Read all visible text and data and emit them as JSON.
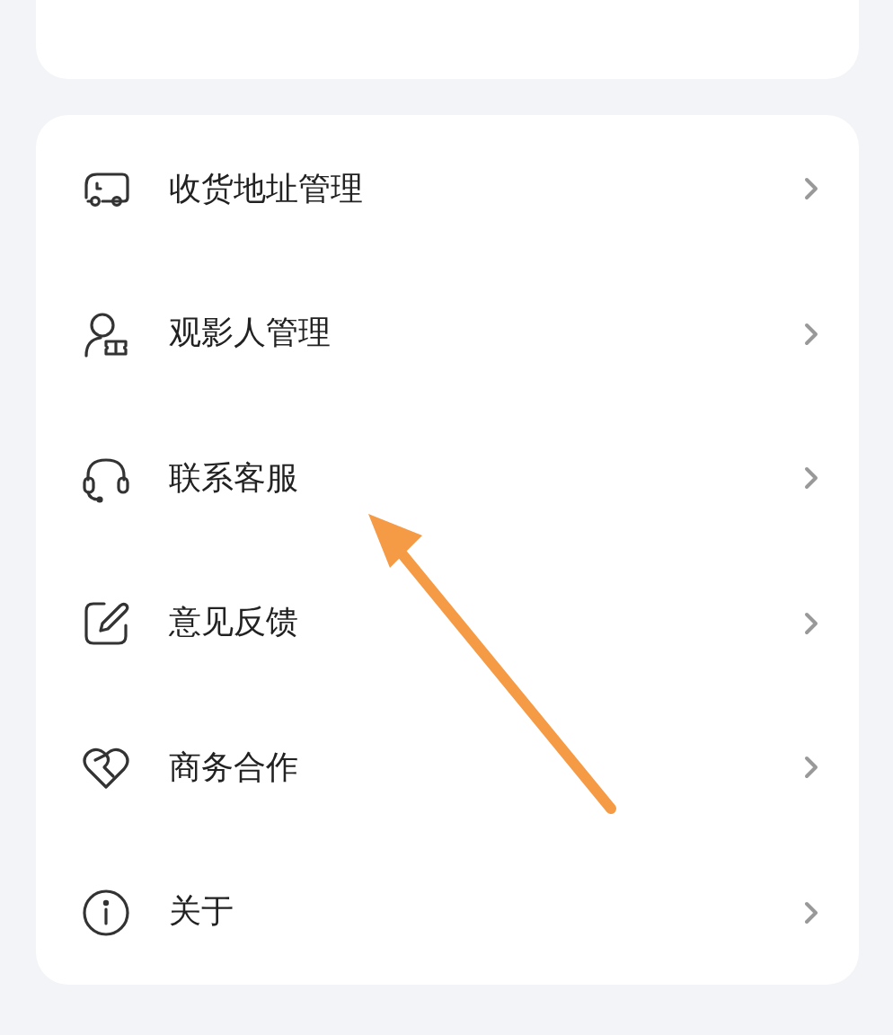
{
  "menu": [
    {
      "kind": "truck",
      "label": "收货地址管理"
    },
    {
      "kind": "viewer",
      "label": "观影人管理"
    },
    {
      "kind": "headset",
      "label": "联系客服"
    },
    {
      "kind": "edit",
      "label": "意见反馈"
    },
    {
      "kind": "handshake",
      "label": "商务合作"
    },
    {
      "kind": "info",
      "label": "关于"
    }
  ]
}
